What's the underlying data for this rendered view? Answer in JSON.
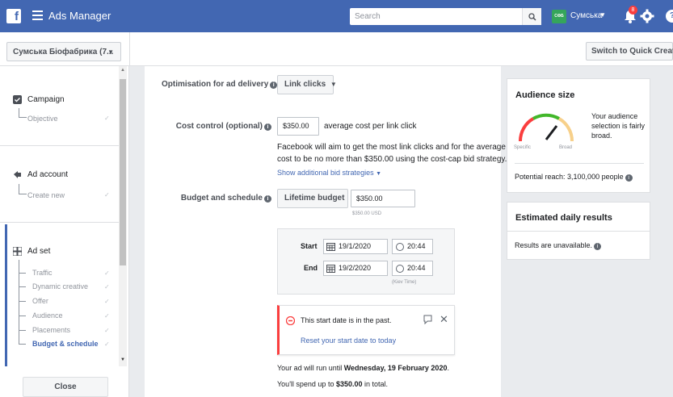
{
  "topbar": {
    "logo": "f",
    "title": "Ads Manager",
    "search_placeholder": "Search",
    "account_pic_text": "СФБ",
    "account_name": "Сумська",
    "notification_count": "8",
    "help": "?"
  },
  "subbar": {
    "account_selector": "Сумська Біофабрика (7...",
    "switch_button": "Switch to Quick Creation"
  },
  "sidebar": {
    "campaign": {
      "title": "Campaign",
      "sub": "Objective"
    },
    "ad_account": {
      "title": "Ad account",
      "sub": "Create new"
    },
    "ad_set": {
      "title": "Ad set",
      "items": [
        "Traffic",
        "Dynamic creative",
        "Offer",
        "Audience",
        "Placements",
        "Budget & schedule"
      ]
    },
    "close": "Close"
  },
  "form": {
    "optimisation_label": "Optimisation for ad delivery",
    "optimisation_value": "Link clicks",
    "cost_label": "Cost control (optional)",
    "cost_value": "$350.00",
    "cost_suffix": "average cost per link click",
    "cost_help_line1": "Facebook will aim to get the most link clicks and for the average",
    "cost_help_line2": "cost to be no more than $350.00 using the cost-cap bid strategy.",
    "bid_link": "Show additional bid strategies",
    "budget_label": "Budget and schedule",
    "budget_type": "Lifetime budget",
    "budget_value": "$350.00",
    "budget_usd": "$350.00 USD",
    "start_label": "Start",
    "start_date": "19/1/2020",
    "start_time": "20:44",
    "end_label": "End",
    "end_date": "19/2/2020",
    "end_time": "20:44",
    "timezone": "(Kiev Time)",
    "alert_text": "This start date is in the past.",
    "alert_link": "Reset your start date to today",
    "run_until_prefix": "Your ad will run until ",
    "run_until_date": "Wednesday, 19 February 2020",
    "run_until_suffix": ".",
    "spend_prefix": "You'll spend up to ",
    "spend_amount": "$350.00",
    "spend_suffix": " in total."
  },
  "audience": {
    "title": "Audience size",
    "desc_line1": "Your audience",
    "desc_line2": "selection is fairly",
    "desc_line3": "broad.",
    "specific": "Specific",
    "broad": "Broad",
    "reach": "Potential reach: 3,100,000 people"
  },
  "daily": {
    "title": "Estimated daily results",
    "text": "Results are unavailable."
  },
  "colors": {
    "brand": "#4267b2",
    "alert": "#fa3e3e",
    "gauge_green": "#42b72a",
    "gauge_red": "#fa3e3e",
    "gauge_yellow": "#f7d08a"
  }
}
